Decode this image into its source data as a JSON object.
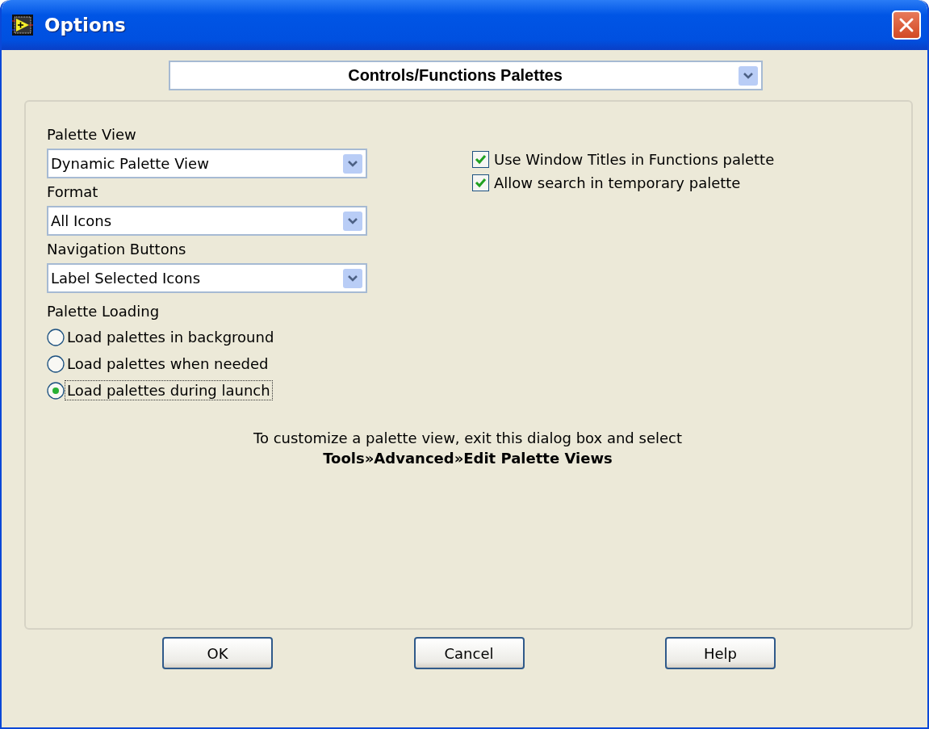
{
  "window": {
    "title": "Options"
  },
  "category": {
    "value": "Controls/Functions Palettes"
  },
  "dropdowns": [
    {
      "label": "Palette View",
      "value": "Dynamic Palette View"
    },
    {
      "label": "Format",
      "value": "All Icons"
    },
    {
      "label": "Navigation Buttons",
      "value": "Label Selected Icons"
    }
  ],
  "palette_loading": {
    "label": "Palette Loading",
    "options": [
      {
        "label": "Load palettes in background",
        "selected": false
      },
      {
        "label": "Load palettes when needed",
        "selected": false
      },
      {
        "label": "Load palettes during launch",
        "selected": true
      }
    ]
  },
  "checkboxes": [
    {
      "label": "Use Window Titles in Functions palette",
      "checked": true
    },
    {
      "label": "Allow search in temporary palette",
      "checked": true
    }
  ],
  "hint": {
    "text": "To customize a palette view, exit this dialog box and select",
    "command": "Tools»Advanced»Edit Palette Views"
  },
  "buttons": [
    "OK",
    "Cancel",
    "Help"
  ]
}
